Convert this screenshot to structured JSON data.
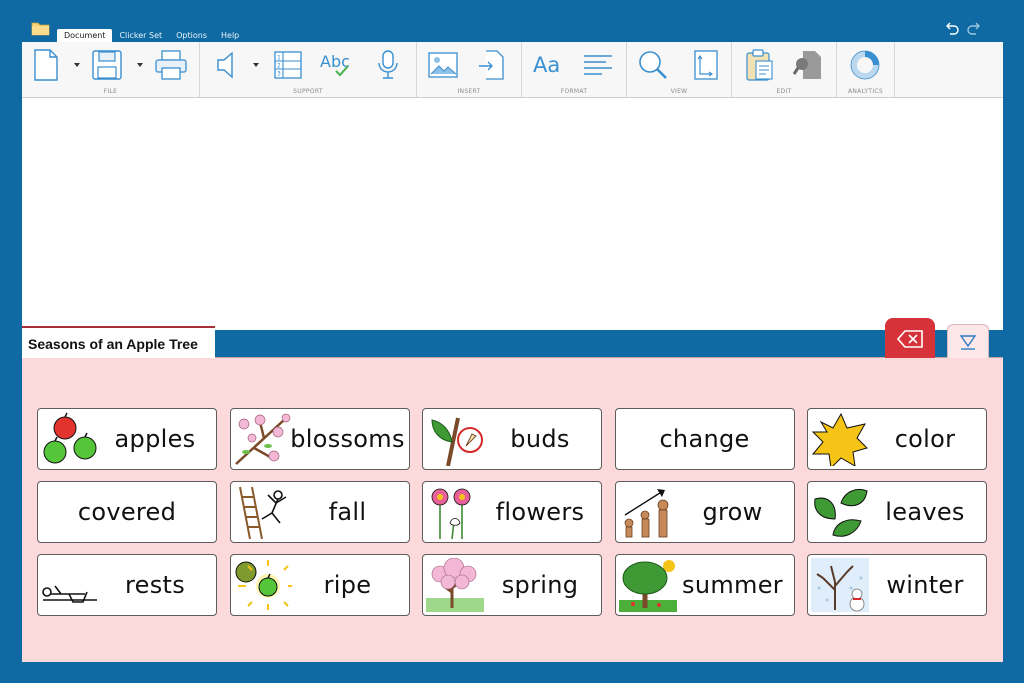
{
  "menu": {
    "tabs": [
      {
        "label": "Document",
        "active": true
      },
      {
        "label": "Clicker Set",
        "active": false
      },
      {
        "label": "Options",
        "active": false
      },
      {
        "label": "Help",
        "active": false
      }
    ]
  },
  "ribbon": {
    "groups": {
      "file": "FILE",
      "support": "SUPPORT",
      "insert": "INSERT",
      "format": "FORMAT",
      "view": "VIEW",
      "edit": "EDIT",
      "analytics": "ANALYTICS"
    },
    "format_font_glyph": "Aa",
    "spell_glyph": "Abc"
  },
  "panel": {
    "title": "Seasons of an Apple Tree"
  },
  "cells": [
    {
      "word": "apples",
      "icon": "apples-icon"
    },
    {
      "word": "blossoms",
      "icon": "blossom-branch-icon"
    },
    {
      "word": "buds",
      "icon": "bud-icon"
    },
    {
      "word": "change",
      "icon": null
    },
    {
      "word": "color",
      "icon": "paint-splash-icon"
    },
    {
      "word": "covered",
      "icon": null
    },
    {
      "word": "fall",
      "icon": "falling-person-icon"
    },
    {
      "word": "flowers",
      "icon": "flowers-icon"
    },
    {
      "word": "grow",
      "icon": "growing-person-icon"
    },
    {
      "word": "leaves",
      "icon": "leaves-icon"
    },
    {
      "word": "rests",
      "icon": "resting-person-icon"
    },
    {
      "word": "ripe",
      "icon": "ripe-apple-icon"
    },
    {
      "word": "spring",
      "icon": "spring-tree-icon"
    },
    {
      "word": "summer",
      "icon": "summer-tree-icon"
    },
    {
      "word": "winter",
      "icon": "winter-tree-icon"
    }
  ],
  "colors": {
    "frame": "#0f6aa3",
    "panel_bg": "#fcd9da",
    "clear_button": "#d6323a",
    "ribbon_icon": "#3a8fd0"
  }
}
